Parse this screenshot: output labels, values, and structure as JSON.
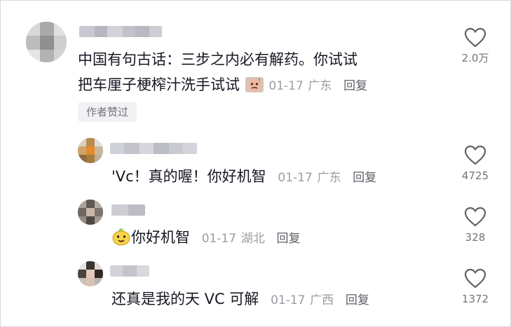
{
  "comments": [
    {
      "line1": "中国有句古话：三步之内必有解药。你试试",
      "line2": "把车厘子梗榨汁洗手试试",
      "date": "01-17",
      "location": "广东",
      "reply": "回复",
      "badge": "作者赞过",
      "likes": "2.0万",
      "emoji": "sweat-face-emoji"
    }
  ],
  "replies": [
    {
      "text": "'Vc！真的喔！你好机智",
      "date": "01-17",
      "location": "广东",
      "reply": "回复",
      "likes": "4725"
    },
    {
      "text": "你好机智",
      "date": "01-17",
      "location": "湖北",
      "reply": "回复",
      "likes": "328",
      "emoji": "smiling-sprout-emoji"
    },
    {
      "text": "还真是我的天 VC 可解",
      "date": "01-17",
      "location": "广西",
      "reply": "回复",
      "likes": "1372"
    }
  ],
  "icons": {
    "like": "heart-outline-icon"
  },
  "colors": {
    "text": "#161823",
    "meta": "#9b9ca3",
    "reply": "#5f6068",
    "badge_bg": "#f2f2f4"
  }
}
